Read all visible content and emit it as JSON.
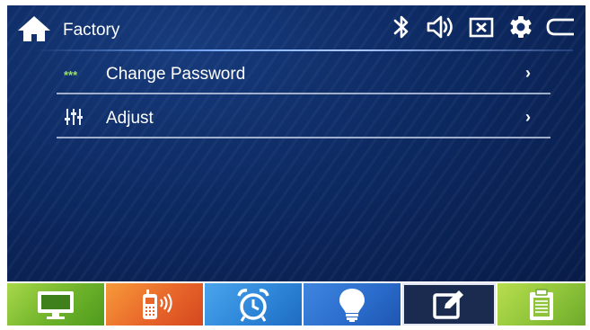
{
  "header": {
    "title": "Factory",
    "icons": [
      "home-icon",
      "bluetooth-icon",
      "volume-icon",
      "mute-icon",
      "settings-icon",
      "back-icon"
    ]
  },
  "menu": {
    "items": [
      {
        "icon": "password-icon",
        "icon_text": "***",
        "label": "Change Password",
        "chevron": "›"
      },
      {
        "icon": "equalizer-icon",
        "label": "Adjust",
        "chevron": "›"
      }
    ]
  },
  "bottom_bar": {
    "tiles": [
      {
        "name": "display",
        "icon": "monitor-icon",
        "color": "#7fbd2c"
      },
      {
        "name": "phone",
        "icon": "phone-icon",
        "color": "#ec6a28"
      },
      {
        "name": "alarm",
        "icon": "alarm-clock-icon",
        "color": "#2f86d8"
      },
      {
        "name": "light",
        "icon": "lightbulb-icon",
        "color": "#2f6fcf"
      },
      {
        "name": "edit",
        "icon": "edit-icon",
        "color": "#1a2b4f",
        "selected": true
      },
      {
        "name": "clipboard",
        "icon": "clipboard-icon",
        "color": "#8fc43a"
      }
    ]
  },
  "colors": {
    "background": "#0d2a63",
    "header_line": "#7fb0ff",
    "stars": "#9be06a",
    "separator": "#b9c6dd"
  }
}
